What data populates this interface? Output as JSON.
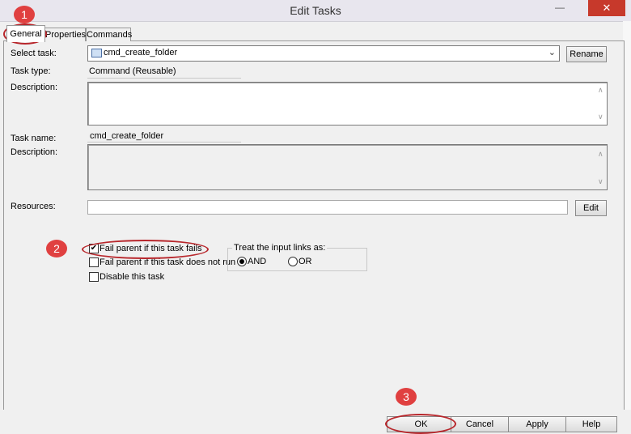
{
  "window": {
    "title": "Edit Tasks",
    "minimize_glyph": "—",
    "close_glyph": "✕"
  },
  "tabs": [
    {
      "label": "General"
    },
    {
      "label": "Properties"
    },
    {
      "label": "Commands"
    }
  ],
  "form": {
    "select_task_label": "Select task:",
    "select_task_value": "cmd_create_folder",
    "rename_label": "Rename",
    "task_type_label": "Task type:",
    "task_type_value": "Command (Reusable)",
    "description1_label": "Description:",
    "task_name_label": "Task name:",
    "task_name_value": "cmd_create_folder",
    "description2_label": "Description:",
    "resources_label": "Resources:",
    "edit_label": "Edit"
  },
  "options": {
    "fail_parent_fails": {
      "label": "Fail parent if this task fails",
      "checked": true
    },
    "fail_parent_not_run": {
      "label": "Fail parent if this task does not run",
      "checked": false
    },
    "disable_task": {
      "label": "Disable this task",
      "checked": false
    }
  },
  "input_links": {
    "label": "Treat the input links as:",
    "and_label": "AND",
    "or_label": "OR",
    "selected": "AND"
  },
  "buttons": {
    "ok": "OK",
    "cancel": "Cancel",
    "apply": "Apply",
    "help": "Help"
  },
  "annotations": {
    "one": "1",
    "two": "2",
    "three": "3"
  },
  "colors": {
    "close": "#c7392b",
    "badge": "#e04040",
    "highlight": "#b8272c"
  }
}
